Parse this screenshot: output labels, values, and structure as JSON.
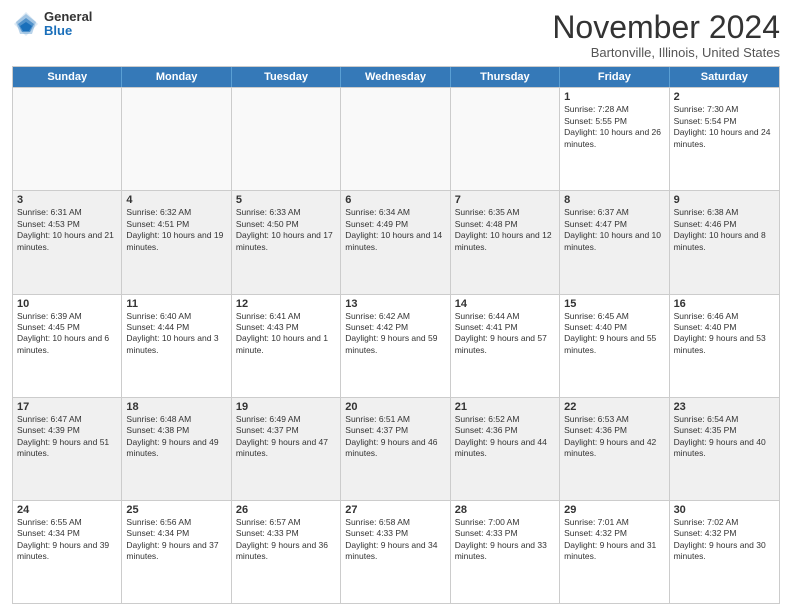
{
  "logo": {
    "general": "General",
    "blue": "Blue"
  },
  "title": "November 2024",
  "location": "Bartonville, Illinois, United States",
  "header_days": [
    "Sunday",
    "Monday",
    "Tuesday",
    "Wednesday",
    "Thursday",
    "Friday",
    "Saturday"
  ],
  "weeks": [
    [
      {
        "day": "",
        "info": ""
      },
      {
        "day": "",
        "info": ""
      },
      {
        "day": "",
        "info": ""
      },
      {
        "day": "",
        "info": ""
      },
      {
        "day": "",
        "info": ""
      },
      {
        "day": "1",
        "info": "Sunrise: 7:28 AM\nSunset: 5:55 PM\nDaylight: 10 hours and 26 minutes."
      },
      {
        "day": "2",
        "info": "Sunrise: 7:30 AM\nSunset: 5:54 PM\nDaylight: 10 hours and 24 minutes."
      }
    ],
    [
      {
        "day": "3",
        "info": "Sunrise: 6:31 AM\nSunset: 4:53 PM\nDaylight: 10 hours and 21 minutes."
      },
      {
        "day": "4",
        "info": "Sunrise: 6:32 AM\nSunset: 4:51 PM\nDaylight: 10 hours and 19 minutes."
      },
      {
        "day": "5",
        "info": "Sunrise: 6:33 AM\nSunset: 4:50 PM\nDaylight: 10 hours and 17 minutes."
      },
      {
        "day": "6",
        "info": "Sunrise: 6:34 AM\nSunset: 4:49 PM\nDaylight: 10 hours and 14 minutes."
      },
      {
        "day": "7",
        "info": "Sunrise: 6:35 AM\nSunset: 4:48 PM\nDaylight: 10 hours and 12 minutes."
      },
      {
        "day": "8",
        "info": "Sunrise: 6:37 AM\nSunset: 4:47 PM\nDaylight: 10 hours and 10 minutes."
      },
      {
        "day": "9",
        "info": "Sunrise: 6:38 AM\nSunset: 4:46 PM\nDaylight: 10 hours and 8 minutes."
      }
    ],
    [
      {
        "day": "10",
        "info": "Sunrise: 6:39 AM\nSunset: 4:45 PM\nDaylight: 10 hours and 6 minutes."
      },
      {
        "day": "11",
        "info": "Sunrise: 6:40 AM\nSunset: 4:44 PM\nDaylight: 10 hours and 3 minutes."
      },
      {
        "day": "12",
        "info": "Sunrise: 6:41 AM\nSunset: 4:43 PM\nDaylight: 10 hours and 1 minute."
      },
      {
        "day": "13",
        "info": "Sunrise: 6:42 AM\nSunset: 4:42 PM\nDaylight: 9 hours and 59 minutes."
      },
      {
        "day": "14",
        "info": "Sunrise: 6:44 AM\nSunset: 4:41 PM\nDaylight: 9 hours and 57 minutes."
      },
      {
        "day": "15",
        "info": "Sunrise: 6:45 AM\nSunset: 4:40 PM\nDaylight: 9 hours and 55 minutes."
      },
      {
        "day": "16",
        "info": "Sunrise: 6:46 AM\nSunset: 4:40 PM\nDaylight: 9 hours and 53 minutes."
      }
    ],
    [
      {
        "day": "17",
        "info": "Sunrise: 6:47 AM\nSunset: 4:39 PM\nDaylight: 9 hours and 51 minutes."
      },
      {
        "day": "18",
        "info": "Sunrise: 6:48 AM\nSunset: 4:38 PM\nDaylight: 9 hours and 49 minutes."
      },
      {
        "day": "19",
        "info": "Sunrise: 6:49 AM\nSunset: 4:37 PM\nDaylight: 9 hours and 47 minutes."
      },
      {
        "day": "20",
        "info": "Sunrise: 6:51 AM\nSunset: 4:37 PM\nDaylight: 9 hours and 46 minutes."
      },
      {
        "day": "21",
        "info": "Sunrise: 6:52 AM\nSunset: 4:36 PM\nDaylight: 9 hours and 44 minutes."
      },
      {
        "day": "22",
        "info": "Sunrise: 6:53 AM\nSunset: 4:36 PM\nDaylight: 9 hours and 42 minutes."
      },
      {
        "day": "23",
        "info": "Sunrise: 6:54 AM\nSunset: 4:35 PM\nDaylight: 9 hours and 40 minutes."
      }
    ],
    [
      {
        "day": "24",
        "info": "Sunrise: 6:55 AM\nSunset: 4:34 PM\nDaylight: 9 hours and 39 minutes."
      },
      {
        "day": "25",
        "info": "Sunrise: 6:56 AM\nSunset: 4:34 PM\nDaylight: 9 hours and 37 minutes."
      },
      {
        "day": "26",
        "info": "Sunrise: 6:57 AM\nSunset: 4:33 PM\nDaylight: 9 hours and 36 minutes."
      },
      {
        "day": "27",
        "info": "Sunrise: 6:58 AM\nSunset: 4:33 PM\nDaylight: 9 hours and 34 minutes."
      },
      {
        "day": "28",
        "info": "Sunrise: 7:00 AM\nSunset: 4:33 PM\nDaylight: 9 hours and 33 minutes."
      },
      {
        "day": "29",
        "info": "Sunrise: 7:01 AM\nSunset: 4:32 PM\nDaylight: 9 hours and 31 minutes."
      },
      {
        "day": "30",
        "info": "Sunrise: 7:02 AM\nSunset: 4:32 PM\nDaylight: 9 hours and 30 minutes."
      }
    ]
  ]
}
